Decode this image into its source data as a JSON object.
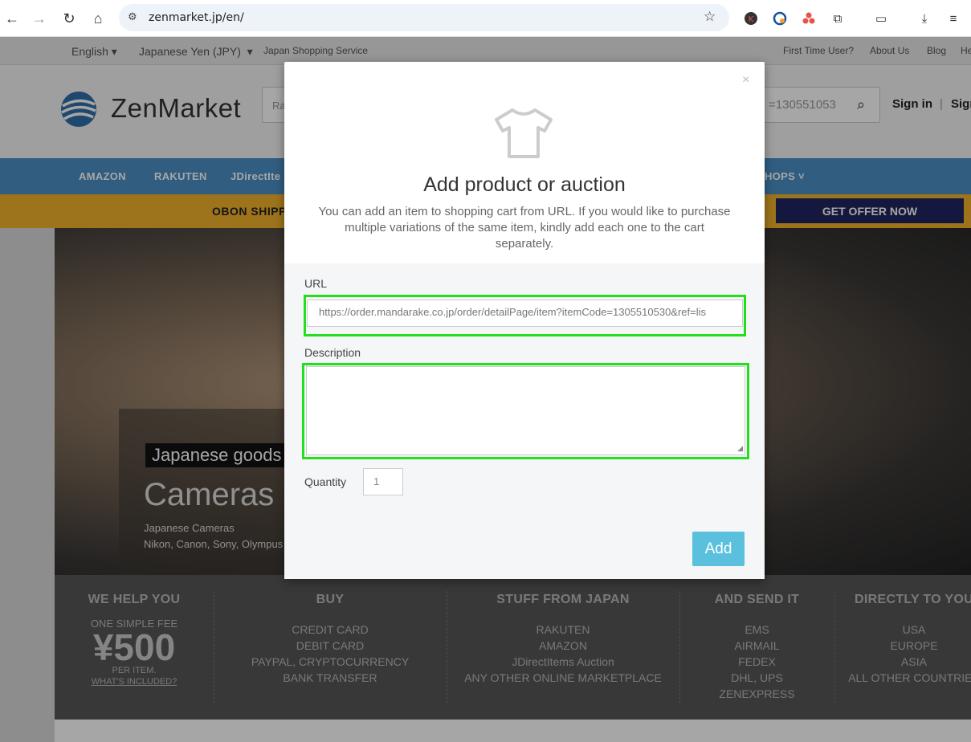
{
  "browser": {
    "url": "zenmarket.jp/en/"
  },
  "topbar": {
    "language": "English",
    "currency": "Japanese Yen (JPY)",
    "service": "Japan Shopping Service",
    "links": [
      "First Time User?",
      "About Us",
      "Blog",
      "He"
    ]
  },
  "header": {
    "logo_text": "ZenMarket",
    "search_left": "Ra",
    "search_right": "=130551053",
    "sign_in": "Sign in",
    "sign_up": "Sign"
  },
  "navbar": {
    "items": [
      "AMAZON",
      "RAKUTEN",
      "JDirectIte",
      "HOPS ˅"
    ]
  },
  "promo": {
    "text": "OBON SHIPP",
    "button": "GET OFFER NOW"
  },
  "hero": {
    "tag": "Japanese goods",
    "title": "Cameras",
    "line1": "Japanese Cameras",
    "line2": "Nikon, Canon, Sony, Olympus"
  },
  "info": {
    "columns": [
      {
        "title": "WE HELP YOU",
        "top": "ONE SIMPLE FEE",
        "fee": "¥500",
        "sub": "PER ITEM.",
        "link": "WHAT'S INCLUDED?"
      },
      {
        "title": "BUY",
        "items": [
          "CREDIT CARD",
          "DEBIT CARD",
          "PAYPAL, CRYPTOCURRENCY",
          "BANK TRANSFER"
        ]
      },
      {
        "title": "STUFF FROM JAPAN",
        "items": [
          "RAKUTEN",
          "AMAZON",
          "JDirectItems Auction",
          "ANY OTHER ONLINE MARKETPLACE"
        ]
      },
      {
        "title": "AND SEND IT",
        "items": [
          "EMS",
          "AIRMAIL",
          "FEDEX",
          "DHL, UPS",
          "ZENEXPRESS"
        ]
      },
      {
        "title": "DIRECTLY TO YOU",
        "items": [
          "USA",
          "EUROPE",
          "ASIA",
          "ALL OTHER COUNTRIES"
        ]
      }
    ]
  },
  "modal": {
    "close": "×",
    "title": "Add product or auction",
    "description": "You can add an item to shopping cart from URL. If you would like to purchase multiple variations of the same item, kindly add each one to the cart separately.",
    "url_label": "URL",
    "url_value": "https://order.mandarake.co.jp/order/detailPage/item?itemCode=1305510530&ref=lis",
    "description_label": "Description",
    "description_value": "",
    "quantity_label": "Quantity",
    "quantity_value": "1",
    "add_button": "Add"
  },
  "colors": {
    "navbar": "#4b8fc5",
    "promo": "#f2b32a",
    "offer_button": "#1f2560",
    "add_button": "#5bc0de",
    "highlight": "#22e01b"
  }
}
